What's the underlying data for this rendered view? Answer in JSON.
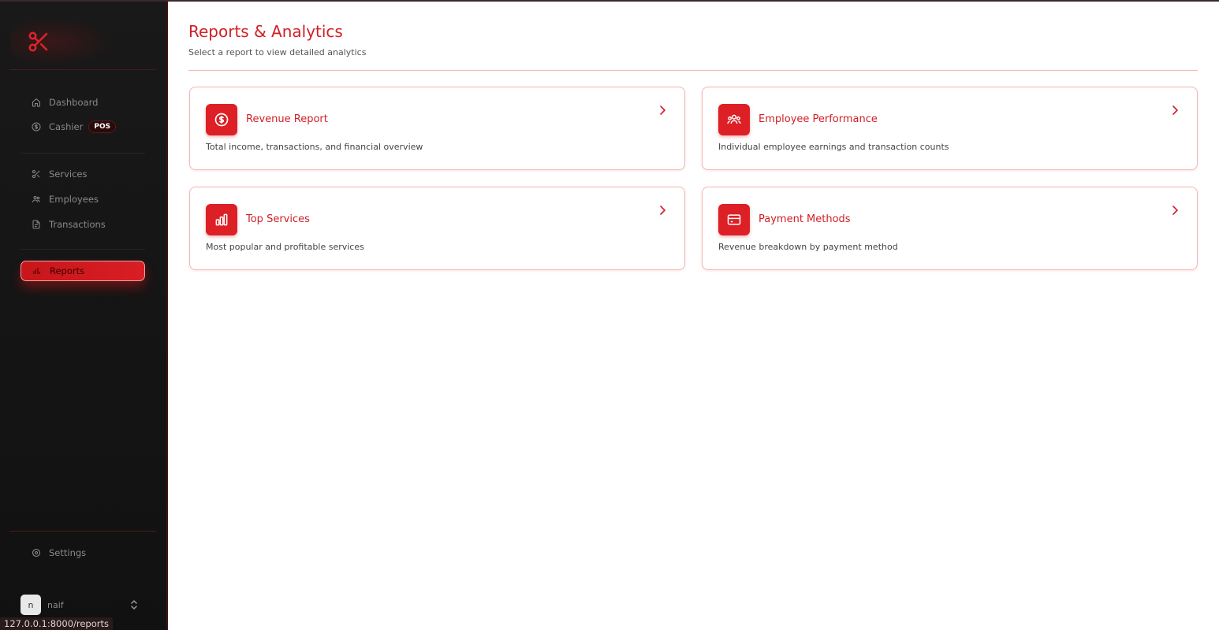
{
  "status_url": "127.0.0.1:8000/reports",
  "sidebar": {
    "nav": [
      {
        "label": "Dashboard",
        "icon": "home-icon"
      },
      {
        "label": "Cashier",
        "icon": "dollar-circle-icon",
        "badge": "POS"
      },
      {
        "label": "Services",
        "icon": "scissors-icon"
      },
      {
        "label": "Employees",
        "icon": "users-icon"
      },
      {
        "label": "Transactions",
        "icon": "file-icon"
      },
      {
        "label": "Reports",
        "icon": "bar-chart-icon",
        "active": true
      }
    ],
    "settings_label": "Settings",
    "user": {
      "initial": "n",
      "name": "naif"
    }
  },
  "main": {
    "title": "Reports & Analytics",
    "subtitle": "Select a report to view detailed analytics",
    "cards": [
      {
        "title": "Revenue Report",
        "description": "Total income, transactions, and financial overview",
        "icon": "dollar-circle-icon"
      },
      {
        "title": "Employee Performance",
        "description": "Individual employee earnings and transaction counts",
        "icon": "users-icon"
      },
      {
        "title": "Top Services",
        "description": "Most popular and profitable services",
        "icon": "bar-chart-icon"
      },
      {
        "title": "Payment Methods",
        "description": "Revenue breakdown by payment method",
        "icon": "credit-card-icon"
      }
    ]
  },
  "colors": {
    "accent": "#dc2026",
    "sidebar_bg": "#151515",
    "border": "#f6b6b6"
  }
}
